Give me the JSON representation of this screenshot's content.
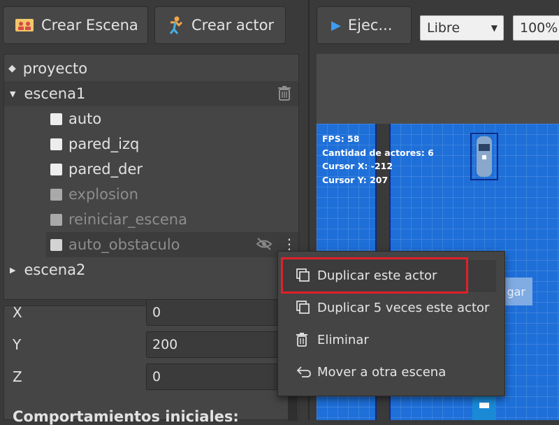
{
  "toolbar": {
    "create_scene_label": "Crear Escena",
    "create_actor_label": "Crear actor",
    "run_label": "Ejec...",
    "mode_select": "Libre",
    "zoom_select": "100%"
  },
  "tree": {
    "project_label": "proyecto",
    "scenes": [
      {
        "label": "escena1"
      },
      {
        "label": "escena2"
      }
    ],
    "actors": [
      {
        "label": "auto",
        "enabled": true
      },
      {
        "label": "pared_izq",
        "enabled": true
      },
      {
        "label": "pared_der",
        "enabled": true
      },
      {
        "label": "explosion",
        "enabled": false
      },
      {
        "label": "reiniciar_escena",
        "enabled": false
      },
      {
        "label": "auto_obstaculo",
        "enabled": false
      }
    ]
  },
  "properties": {
    "x_label": "X",
    "x_value": "0",
    "y_label": "Y",
    "y_value": "200",
    "z_label": "Z",
    "z_value": "0",
    "behaviors_heading": "Comportamientos iniciales:"
  },
  "canvas": {
    "fps": "FPS: 58",
    "actor_count": "Cantidad de actores: 6",
    "cursor_x": "Cursor X: -212",
    "cursor_y": "Cursor Y: 207",
    "hidden_button_label": "gar"
  },
  "context_menu": {
    "items": [
      {
        "label": "Duplicar este actor",
        "icon": "duplicate-icon",
        "highlighted": true
      },
      {
        "label": "Duplicar 5 veces este actor",
        "icon": "duplicate-icon"
      },
      {
        "label": "Eliminar",
        "icon": "trash-icon"
      },
      {
        "label": "Mover a otra escena",
        "icon": "undo-arrow-icon"
      }
    ]
  },
  "colors": {
    "highlight_border": "#e0202a",
    "water": "#1e6fd8",
    "panel": "#454545"
  }
}
